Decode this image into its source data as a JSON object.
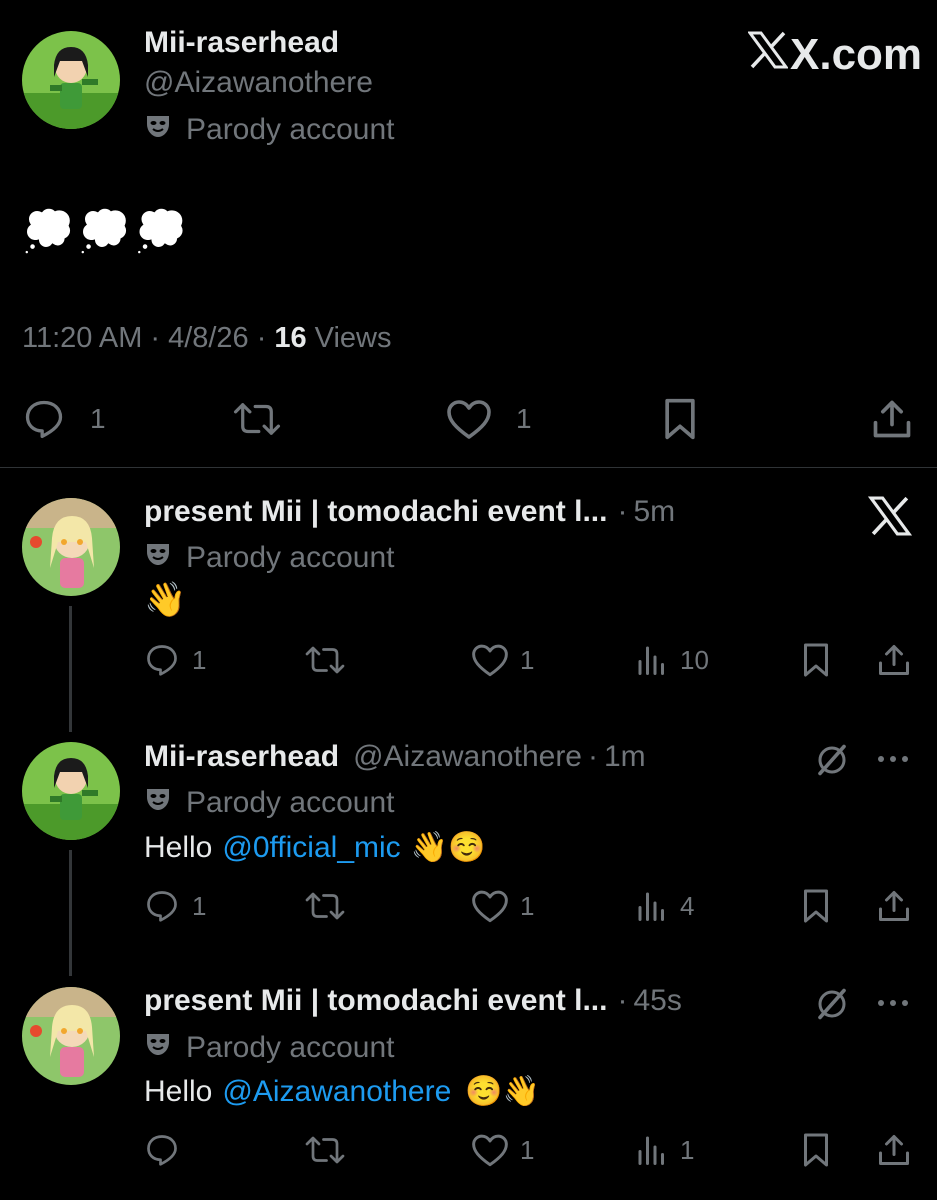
{
  "main_tweet": {
    "display_name": "Mii-raserhead",
    "handle": "@Aizawanothere",
    "label": "Parody account",
    "brand": "X.com",
    "text": "💭💭💭",
    "time": "11:20 AM",
    "date": "4/8/26",
    "views_count": "16",
    "views_label": "Views",
    "replies": "1",
    "likes": "1"
  },
  "replies": [
    {
      "display_name": "present Mii | tomodachi event l...",
      "age": "5m",
      "label": "Parody account",
      "text": "👋",
      "replies": "1",
      "likes": "1",
      "views": "10"
    },
    {
      "display_name": "Mii-raserhead",
      "handle": "@Aizawanothere",
      "age": "1m",
      "label": "Parody account",
      "text_prefix": "Hello",
      "mention": "@0fficial_mic",
      "text_suffix": "👋☺️",
      "replies": "1",
      "likes": "1",
      "views": "4"
    },
    {
      "display_name": "present Mii | tomodachi event l...",
      "age": "45s",
      "label": "Parody account",
      "text_prefix": "Hello",
      "mention": "@Aizawanothere",
      "text_suffix": "☺️👋",
      "replies": "",
      "likes": "1",
      "views": "1"
    }
  ],
  "colors": {
    "background": "#000000",
    "text": "#e7e9ea",
    "muted": "#71767b",
    "link": "#1d9bf0",
    "divider": "#2f3336"
  },
  "icons": [
    "x-logo-icon",
    "mask-icon",
    "reply-icon",
    "retweet-icon",
    "like-icon",
    "bookmark-icon",
    "share-icon",
    "views-icon",
    "grok-icon",
    "more-icon"
  ]
}
